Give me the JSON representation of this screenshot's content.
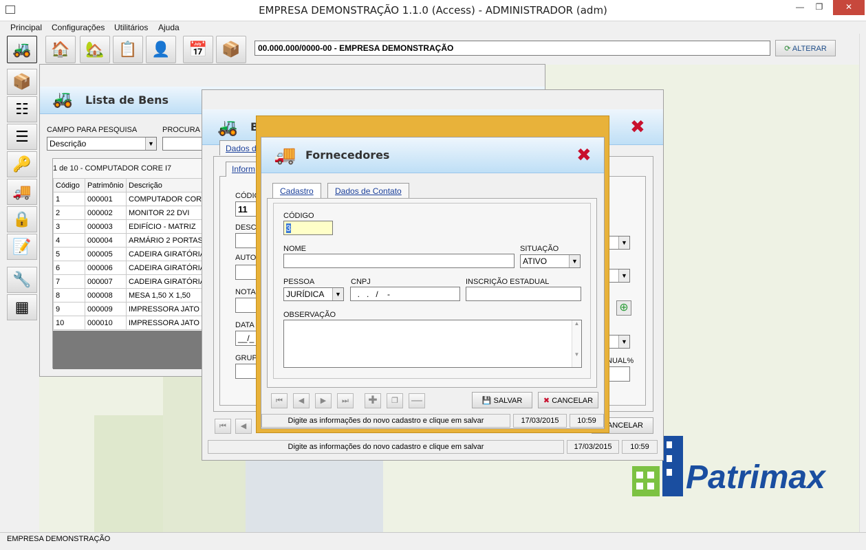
{
  "window": {
    "title": "EMPRESA DEMONSTRAÇÃO 1.1.0 (Access) - ADMINISTRADOR (adm)"
  },
  "menu": [
    "Principal",
    "Configurações",
    "Utilitários",
    "Ajuda"
  ],
  "toolbar": {
    "company": "00.000.000/0000-00 - EMPRESA DEMONSTRAÇÃO",
    "alterar_label": "ALTERAR"
  },
  "statusbar": {
    "text": "EMPRESA DEMONSTRAÇÃO"
  },
  "lista": {
    "title": "Lista de Bens",
    "campo_label": "CAMPO PARA PESQUISA",
    "campo_value": "Descrição",
    "procura_label": "PROCURA P",
    "count": "1 de 10 - COMPUTADOR CORE I7",
    "columns": [
      "Código",
      "Patrimônio",
      "Descrição"
    ],
    "rows": [
      [
        "1",
        "000001",
        "COMPUTADOR CORE I"
      ],
      [
        "2",
        "000002",
        "MONITOR 22 DVI"
      ],
      [
        "3",
        "000003",
        "EDIFÍCIO - MATRIZ"
      ],
      [
        "4",
        "000004",
        "ARMÁRIO 2 PORTAS"
      ],
      [
        "5",
        "000005",
        "CADEIRA GIRATÓRIA"
      ],
      [
        "6",
        "000006",
        "CADEIRA GIRATÓRIA"
      ],
      [
        "7",
        "000007",
        "CADEIRA GIRATÓRIA"
      ],
      [
        "8",
        "000008",
        "MESA 1,50 X 1,50"
      ],
      [
        "9",
        "000009",
        "IMPRESSORA JATO DE"
      ],
      [
        "10",
        "000010",
        "IMPRESSORA JATO DE"
      ]
    ]
  },
  "bens": {
    "title": "B",
    "tab_dados": "Dados d",
    "tab_inform": "Inform",
    "codigo_label": "CÓDIG",
    "codigo_value": "11",
    "descr_label": "DESCR",
    "autor_label": "AUTOR",
    "nota_label": "NOTA",
    "data_label": "DATA",
    "data_value": "__/_",
    "grupo_label": "GRUPO",
    "anual_label": "NUAL%",
    "cancelar_label": "CANCELAR",
    "status_msg": "Digite as informações do novo cadastro e clique em salvar",
    "status_date": "17/03/2015",
    "status_time": "10:59"
  },
  "fornecedores": {
    "title": "Fornecedores",
    "tabs": [
      "Cadastro",
      "Dados de Contato"
    ],
    "codigo_label": "CÓDIGO",
    "codigo_value": "3",
    "nome_label": "NOME",
    "nome_value": "",
    "situacao_label": "SITUAÇÃO",
    "situacao_value": "ATIVO",
    "pessoa_label": "PESSOA",
    "pessoa_value": "JURÍDICA",
    "cnpj_label": "CNPJ",
    "cnpj_value": "  .   .   /    -",
    "ie_label": "INSCRIÇÃO ESTADUAL",
    "obs_label": "OBSERVAÇÃO",
    "salvar_label": "SALVAR",
    "cancelar_label": "CANCELAR",
    "status_msg": "Digite as informações do novo cadastro e clique em salvar",
    "status_date": "17/03/2015",
    "status_time": "10:59"
  },
  "logo": {
    "text": "Patrimax"
  },
  "colors": {
    "accent_blue": "#1f4e8a",
    "logo_green": "#7cc242",
    "logo_blue": "#1a4ea0",
    "frame_gold": "#e8b23a"
  }
}
